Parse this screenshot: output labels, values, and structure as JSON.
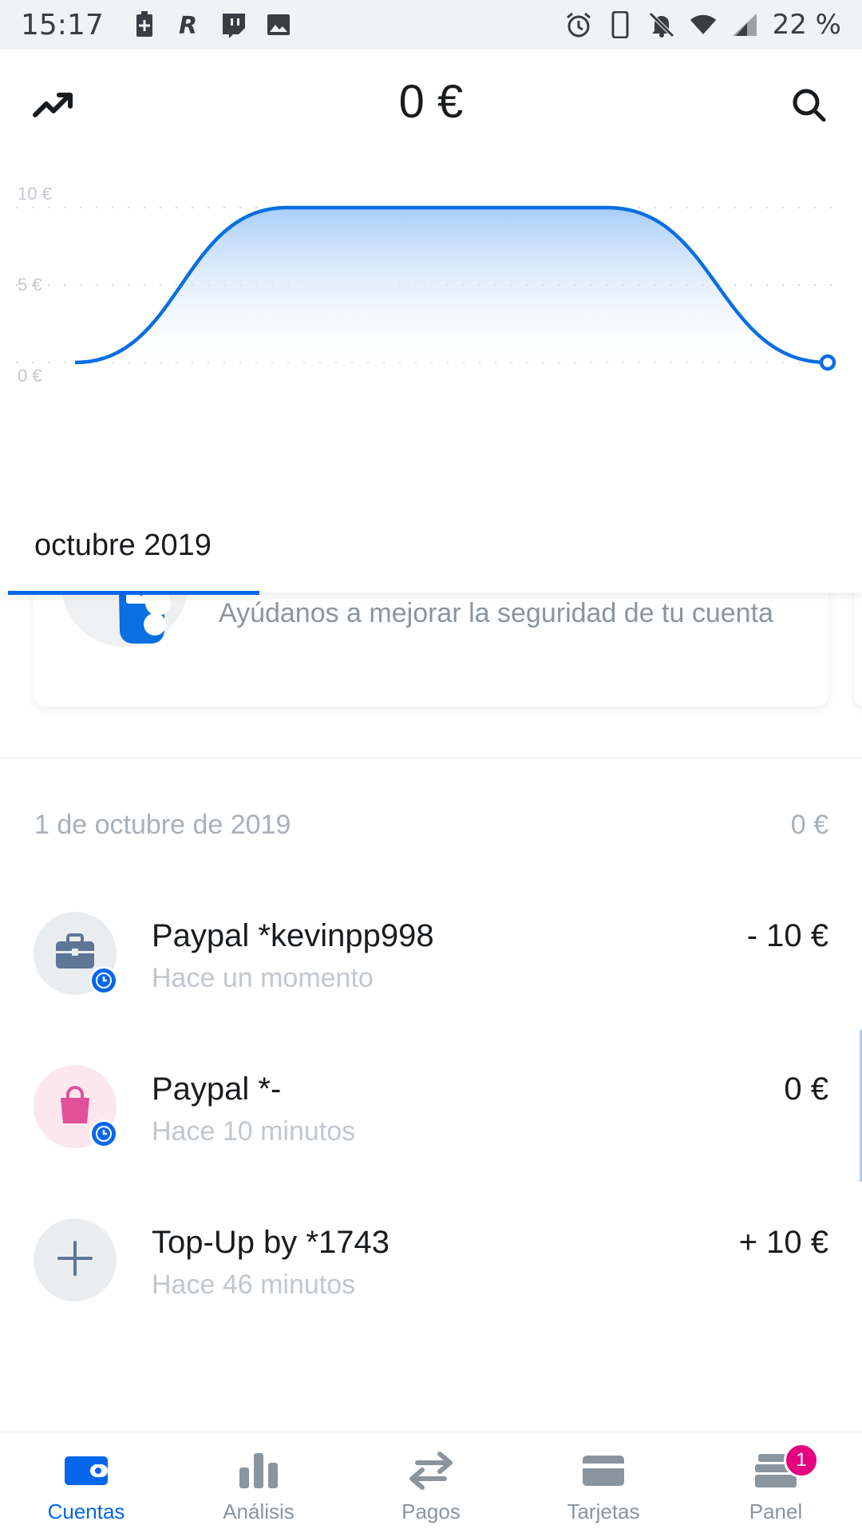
{
  "status_bar": {
    "time": "15:17",
    "battery_percent": "22 %",
    "left_icons": [
      "battery-saver-icon",
      "r-app-icon",
      "twitch-icon",
      "image-icon"
    ],
    "right_icons": [
      "alarm-icon",
      "phone-icon",
      "bell-off-icon",
      "wifi-icon",
      "signal-icon"
    ]
  },
  "header": {
    "balance": "0 €",
    "left_icon": "trending-up-icon",
    "right_icon": "search-icon"
  },
  "chart_data": {
    "type": "area",
    "y_ticks": [
      "10 €",
      "5 €",
      "0 €"
    ],
    "ylim": [
      0,
      10
    ],
    "x_label": "octubre 2019",
    "series": [
      {
        "values": [
          0,
          10,
          10,
          0
        ]
      }
    ],
    "colors": {
      "line": "#0a6fe0",
      "fill_top": "#a8cdf8"
    },
    "grid": "dotted"
  },
  "month_tab": "octubre 2019",
  "security_card": {
    "text": "Ayúdanos a mejorar la seguridad de tu cuenta"
  },
  "transactions": {
    "date": "1 de octubre de 2019",
    "day_total": "0 €",
    "items": [
      {
        "title": "Paypal *kevinpp998",
        "subtitle": "Hace un momento",
        "amount": "- 10 €",
        "icon": "briefcase-icon",
        "pending": true
      },
      {
        "title": "Paypal *-",
        "subtitle": "Hace 10 minutos",
        "amount": "0 €",
        "icon": "shopping-bag-icon",
        "pending": true
      },
      {
        "title": "Top-Up by *1743",
        "subtitle": "Hace 46 minutos",
        "amount": "+ 10 €",
        "icon": "plus-icon",
        "pending": false
      }
    ]
  },
  "bottom_nav": {
    "items": [
      {
        "label": "Cuentas",
        "icon": "wallet-icon",
        "active": true
      },
      {
        "label": "Análisis",
        "icon": "bar-chart-icon",
        "active": false
      },
      {
        "label": "Pagos",
        "icon": "transfer-arrows-icon",
        "active": false
      },
      {
        "label": "Tarjetas",
        "icon": "card-icon",
        "active": false
      },
      {
        "label": "Panel",
        "icon": "dashboard-icon",
        "active": false,
        "badge": "1"
      }
    ]
  },
  "colors": {
    "accent": "#0666eb",
    "badge": "#e5007d"
  }
}
